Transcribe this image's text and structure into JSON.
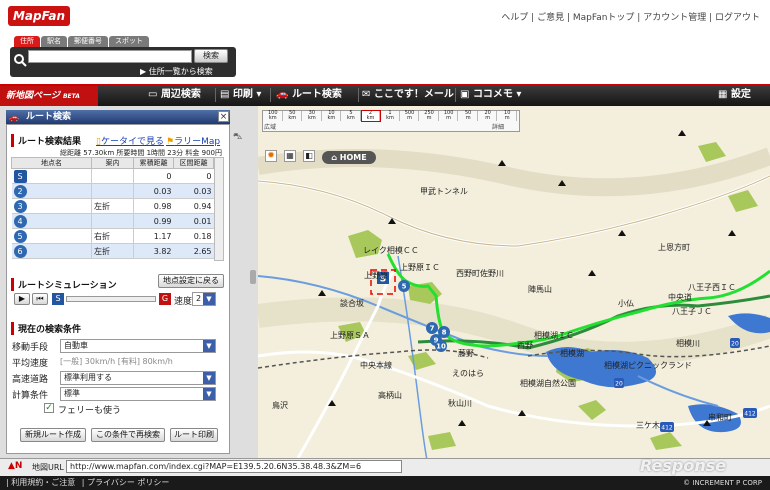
{
  "header": {
    "logo": "MapFan",
    "links": [
      "ヘルプ",
      "ご意見",
      "MapFanトップ",
      "アカウント管理",
      "ログアウト"
    ]
  },
  "search": {
    "tabs": [
      "住所",
      "駅名",
      "郵便番号",
      "スポット"
    ],
    "button": "検索",
    "address_list_link": "住所一覧から検索",
    "value": ""
  },
  "toolbar": {
    "new_map_label": "新地図ページ",
    "beta": "BETA",
    "items": [
      "周辺検索",
      "印刷",
      "ルート検索",
      "ここです！メール",
      "ココメモ"
    ],
    "settings": "設定"
  },
  "panel": {
    "title": "ルート検索",
    "results_header": "ルート検索結果",
    "link_mobile": "ケータイで見る",
    "link_rally": "ラリーMap",
    "summary": "総距離 57.30km 所要時間 1時間 23分 料金 900円",
    "columns": [
      "地点名",
      "案内",
      "累積距離",
      "区間距離"
    ],
    "rows": [
      {
        "id": "S",
        "turn": "",
        "total": "0",
        "section": "0"
      },
      {
        "id": "2",
        "turn": "",
        "total": "0.03",
        "section": "0.03"
      },
      {
        "id": "3",
        "turn": "左折",
        "total": "0.98",
        "section": "0.94"
      },
      {
        "id": "4",
        "turn": "",
        "total": "0.99",
        "section": "0.01"
      },
      {
        "id": "5",
        "turn": "右折",
        "total": "1.17",
        "section": "0.18"
      },
      {
        "id": "6",
        "turn": "左折",
        "total": "3.82",
        "section": "2.65"
      }
    ],
    "simulation_header": "ルートシミュレーション",
    "reset_button": "地点設定に戻る",
    "speed_label": "速度",
    "speed_value": "2",
    "conditions_header": "現在の検索条件",
    "conditions": [
      {
        "label": "移動手段",
        "value": "自動車"
      },
      {
        "label": "平均速度",
        "value": "[一般] 30km/h [有料] 80km/h"
      },
      {
        "label": "高速道路",
        "value": "標準利用する"
      },
      {
        "label": "計算条件",
        "value": "標準"
      }
    ],
    "ferry_label": "フェリーも使う",
    "ferry_checked": true,
    "buttons": [
      "新規ルート作成",
      "この条件で再検索",
      "ルート印刷"
    ]
  },
  "map": {
    "home_label": "HOME",
    "scale_marks": [
      "100",
      "50",
      "30",
      "10",
      "5",
      "2",
      "1",
      "500",
      "250",
      "100",
      "50",
      "20",
      "10"
    ],
    "scale_units": [
      "km",
      "km",
      "km",
      "km",
      "km",
      "km",
      "km",
      "m",
      "m",
      "m",
      "m",
      "m",
      "m"
    ],
    "scale_hint_left": "広域",
    "scale_hint_right": "詳細",
    "labels": [
      "甲武トンネル",
      "レイク相模ＣＣ",
      "上野原",
      "上野原ＩＣ",
      "西野町佐野川",
      "相模湖ＩＣ",
      "相模湖",
      "相模湖自然公園",
      "八王子西ＩＣ",
      "八王子ＪＣ",
      "上恩方町",
      "中央道",
      "小仏",
      "陣馬山",
      "高柄山",
      "秋山川",
      "えのはら",
      "談合坂",
      "中央本線",
      "西野",
      "藤野",
      "相模湖ピクニックランド",
      "三ケ木",
      "串和町",
      "相模川",
      "鳥沢",
      "上野原ＳＡ"
    ],
    "copyright": "© INCREMENT P CORP"
  },
  "url": {
    "label": "地図URL",
    "value": "http://www.mapfan.com/index.cgi?MAP=E139.5.20.6N35.38.48.3&ZM=6"
  },
  "footer": {
    "links": [
      "利用規約・ご注意",
      "プライバシー ポリシー"
    ],
    "copyright": "© INCREMENT P CORP"
  },
  "watermark": "Response",
  "colors": {
    "brand_red": "#cc1111",
    "route_green": "#22c832",
    "toolbar_dark": "#1f1f1f",
    "panel_blue": "#2d68b0"
  }
}
